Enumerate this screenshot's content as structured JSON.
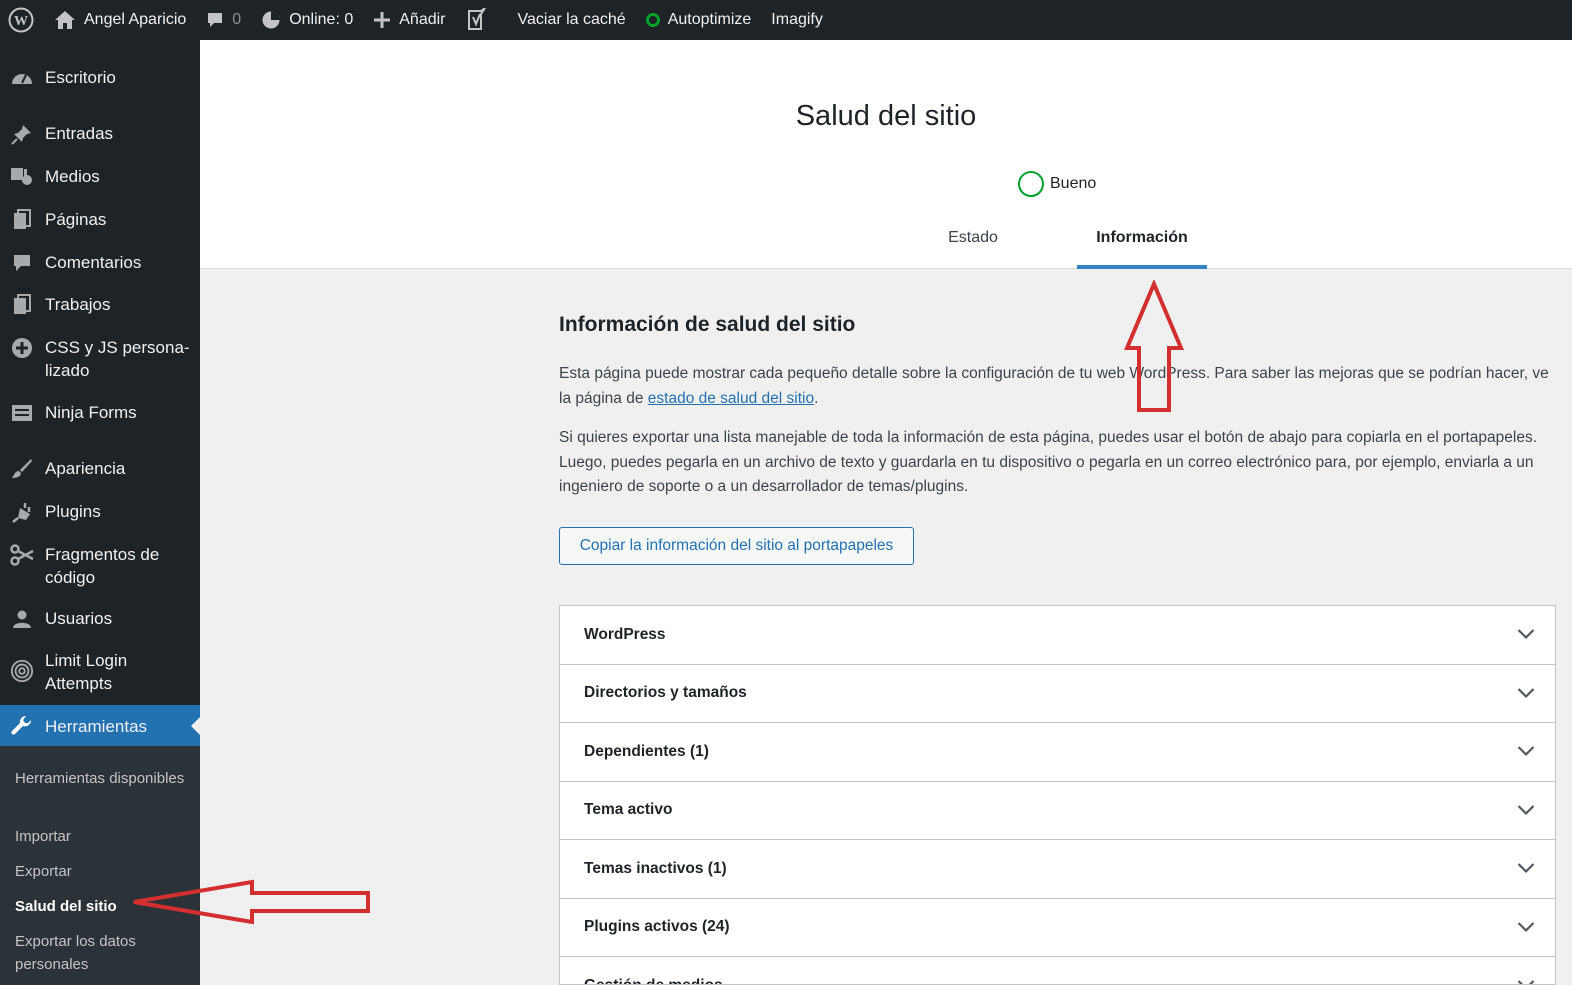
{
  "admin_bar": {
    "site_name": "Angel Aparicio",
    "comments_count": "0",
    "online": "Online: 0",
    "add_new": "Añadir",
    "clear_cache": "Vaciar la caché",
    "autoptimize": "Autoptimize",
    "imagify": "Imagify",
    "colors": {
      "background": "#1d2327",
      "status_ok": "#00a32a"
    }
  },
  "sidebar": {
    "items": [
      {
        "label": "Escritorio",
        "icon": "dashboard-icon"
      },
      {
        "label": "Entradas",
        "icon": "pin-icon"
      },
      {
        "label": "Medios",
        "icon": "media-icon"
      },
      {
        "label": "Páginas",
        "icon": "pages-icon"
      },
      {
        "label": "Comentarios",
        "icon": "comment-icon"
      },
      {
        "label": "Trabajos",
        "icon": "pages-icon"
      },
      {
        "label": "CSS y JS persona-lizado",
        "icon": "plus-circle-icon"
      },
      {
        "label": "Ninja Forms",
        "icon": "forms-icon"
      },
      {
        "label": "Apariencia",
        "icon": "brush-icon"
      },
      {
        "label": "Plugins",
        "icon": "plugin-icon"
      },
      {
        "label": "Fragmentos de código",
        "icon": "scissors-icon"
      },
      {
        "label": "Usuarios",
        "icon": "user-icon"
      },
      {
        "label": "Limit Login Attempts",
        "icon": "fingerprint-icon"
      },
      {
        "label": "Herramientas",
        "icon": "wrench-icon"
      }
    ],
    "submenu": [
      {
        "label": "Herramientas disponibles"
      },
      {
        "label": "Importar"
      },
      {
        "label": "Exportar"
      },
      {
        "label": "Salud del sitio"
      },
      {
        "label": "Exportar los datos personales"
      }
    ],
    "colors": {
      "background": "#1d2327",
      "submenu_bg": "#2c3338",
      "current_bg": "#2271b1"
    }
  },
  "header": {
    "title": "Salud del sitio",
    "status": "Bueno",
    "tabs": [
      {
        "label": "Estado"
      },
      {
        "label": "Información"
      }
    ],
    "active_tab": "Información"
  },
  "main": {
    "section_title": "Información de salud del sitio",
    "para1_text": "Esta página puede mostrar cada pequeño detalle sobre la configuración de tu web WordPress. Para saber las mejoras que se podrían hacer, ve la página de ",
    "para1_link": "estado de salud del sitio",
    "para1_end": ".",
    "para2": "Si quieres exportar una lista manejable de toda la información de esta página, puedes usar el botón de abajo para copiarla en el portapapeles. Luego, puedes pegarla en un archivo de texto y guardarla en tu dispositivo o pegarla en un correo electrónico para, por ejemplo, enviarla a un ingeniero de soporte o a un desarrollador de temas/plugins.",
    "copy_button": "Copiar la información del sitio al portapapeles",
    "accordion": [
      {
        "label": "WordPress"
      },
      {
        "label": "Directorios y tamaños"
      },
      {
        "label": "Dependientes (1)"
      },
      {
        "label": "Tema activo"
      },
      {
        "label": "Temas inactivos (1)"
      },
      {
        "label": "Plugins activos (24)"
      },
      {
        "label": "Gestión de medios"
      }
    ],
    "colors": {
      "accent": "#2271b1",
      "tab_indicator": "#3582c4",
      "annotation": "#d32f2f"
    }
  }
}
